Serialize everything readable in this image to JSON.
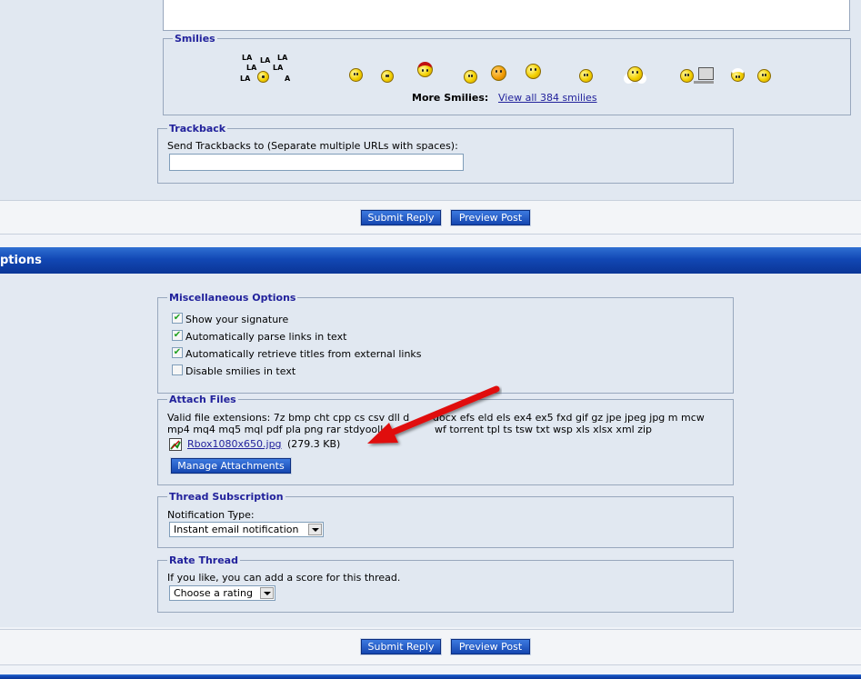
{
  "smilies": {
    "legend": "Smilies",
    "lalala": [
      "LA",
      "LA",
      "LA",
      "LA",
      "LA",
      "LA",
      "A"
    ],
    "icons": [
      "lalala-smiley-icon",
      "pigtails-smiley-icon",
      "smile-icon",
      "pirate-smiley-icon",
      "sleepy-smiley-icon",
      "laughing-smiley-icon",
      "confused-smiley-icon",
      "peeking-smiley-icon",
      "cloud-smiley-icon",
      "computer-smiley-icon",
      "chef-smiley-icon",
      "grin-smiley-icon"
    ],
    "more_label": "More Smilies:",
    "view_all": "View all 384 smilies"
  },
  "trackback": {
    "legend": "Trackback",
    "label": "Send Trackbacks to (Separate multiple URLs with spaces):",
    "value": ""
  },
  "buttons": {
    "submit": "Submit Reply",
    "preview": "Preview Post"
  },
  "options_band": {
    "title": "ptions"
  },
  "misc": {
    "legend": "Miscellaneous Options",
    "items": [
      {
        "label": "Show your signature",
        "checked": true
      },
      {
        "label": "Automatically parse links in text",
        "checked": true
      },
      {
        "label": "Automatically retrieve titles from external links",
        "checked": true
      },
      {
        "label": "Disable smilies in text",
        "checked": false
      }
    ]
  },
  "attach": {
    "legend": "Attach Files",
    "ext_line1": "Valid file extensions: 7z bmp cht cpp cs csv dll d",
    "ext_line1_end": "docx efs eld els ex4 ex5 fxd gif gz jpe jpeg jpg m mcw",
    "ext_line2": "mp4 mq4 mq5 mql pdf pla png rar stdyoolle",
    "ext_line2_end": "wf torrent tpl ts tsw txt wsp xls xlsx xml zip",
    "file_name": "Rbox1080x650.jpg",
    "file_size": "(279.3 KB)",
    "manage": "Manage Attachments"
  },
  "subscription": {
    "legend": "Thread Subscription",
    "label": "Notification Type:",
    "selected": "Instant email notification"
  },
  "rate": {
    "legend": "Rate Thread",
    "label": "If you like, you can add a score for this thread.",
    "selected": "Choose a rating"
  },
  "colors": {
    "band_blue": "#1248b5",
    "legend_text": "#22229c",
    "arrow_red": "#e01010"
  }
}
